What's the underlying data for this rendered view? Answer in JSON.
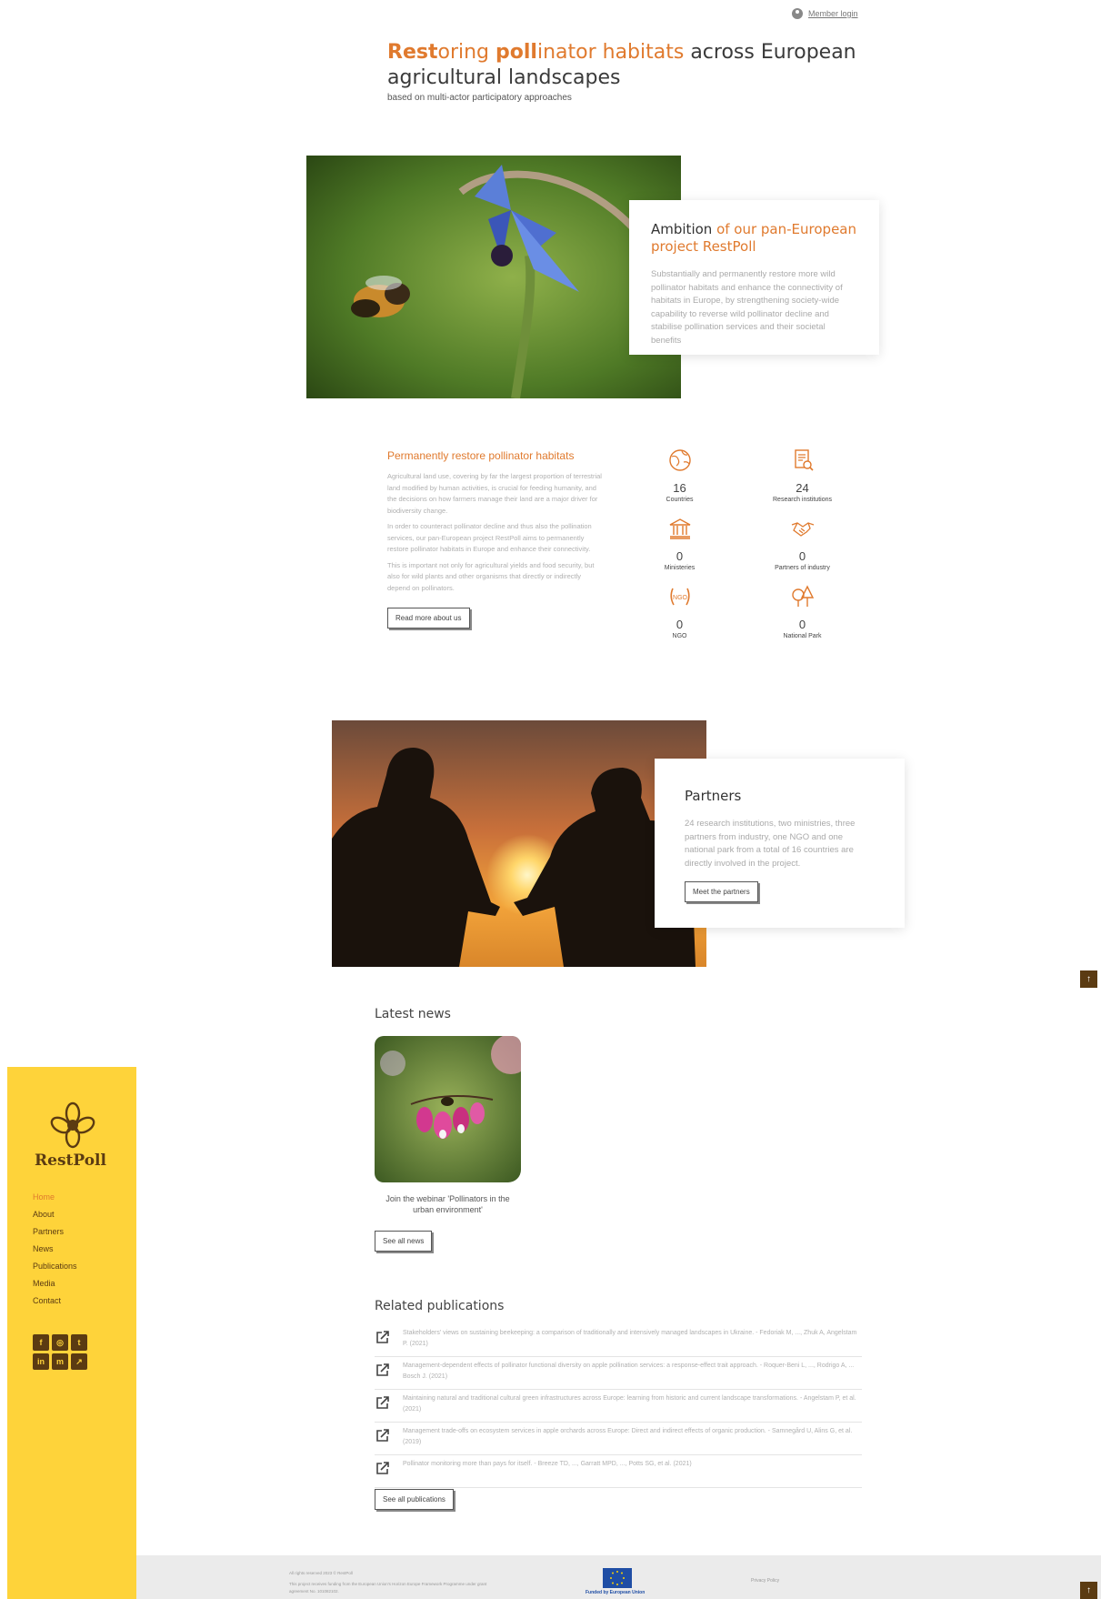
{
  "header": {
    "member_login": "Member login"
  },
  "hero": {
    "title_parts": [
      "Rest",
      "oring ",
      "poll",
      "inator habitats",
      " across European agricultural landscapes"
    ],
    "subtitle": "based on multi-actor participatory approaches"
  },
  "ambition": {
    "title_a": "Ambition",
    "title_b": " of our pan-European project RestPoll",
    "text": "Substantially and permanently restore more wild pollinator habitats and enhance the connectivity of habitats in Europe, by strengthening society-wide capability to reverse wild pollinator decline and stabilise pollination services and their societal benefits"
  },
  "restore": {
    "title": "Permanently restore pollinator habitats",
    "paragraphs": [
      "Agricultural land use, covering by far the largest proportion of terrestrial land modified by human activities, is crucial for feeding humanity, and the decisions on how farmers manage their land are a major driver for biodiversity change.",
      "In order to counteract pollinator decline and thus also the pollination services, our pan-European project RestPoll aims to permanently restore pollinator habitats in Europe and enhance their connectivity.",
      "This is important not only for agricultural yields and food security, but also for wild plants and other organisms that directly or indirectly depend on pollinators."
    ],
    "button": "Read more about us"
  },
  "stats": [
    {
      "icon": "globe-icon",
      "value": "16",
      "label": "Countries"
    },
    {
      "icon": "research-document-icon",
      "value": "24",
      "label": "Research institutions"
    },
    {
      "icon": "ministry-building-icon",
      "value": "0",
      "label": "Ministeries"
    },
    {
      "icon": "handshake-icon",
      "value": "0",
      "label": "Partners of industry"
    },
    {
      "icon": "ngo-laurel-icon",
      "value": "0",
      "label": "NGO"
    },
    {
      "icon": "trees-icon",
      "value": "0",
      "label": "National Park"
    }
  ],
  "partners": {
    "title": "Partners",
    "text": "24 research institutions, two ministries, three partners from industry, one NGO and one national park from a total of 16 countries are directly involved in the project.",
    "button": "Meet the partners"
  },
  "news": {
    "title": "Latest news",
    "item_caption": "Join the webinar 'Pollinators in the urban environment'",
    "button": "See all news"
  },
  "publications": {
    "title": "Related publications",
    "items": [
      "Stakeholders' views on sustaining beekeeping: a comparison of traditionally and intensively managed landscapes in Ukraine. - Fedoriak M, ..., Zhuk A, Angelstam P. (2021)",
      "Management-dependent effects of pollinator functional diversity on apple pollination services: a response-effect trait approach. - Roquer-Beni L, ..., Rodrigo A, ... Bosch J. (2021)",
      "Maintaining natural and traditional cultural green infrastructures across Europe: learning from historic and current landscape transformations. - Angelstam P, et al. (2021)",
      "Management trade-offs on ecosystem services in apple orchards across Europe: Direct and indirect effects of organic production. - Samnegård U, Alins G, et al. (2019)",
      "Pollinator monitoring more than pays for itself. - Breeze TD, ..., Garratt MPD, ..., Potts SG, et al. (2021)"
    ],
    "button": "See all publications"
  },
  "sidebar": {
    "brand": "RestPoll",
    "nav": [
      "Home",
      "About",
      "Partners",
      "News",
      "Publications",
      "Media",
      "Contact"
    ],
    "socials": [
      {
        "icon": "facebook-icon",
        "glyph": "f"
      },
      {
        "icon": "instagram-icon",
        "glyph": "◎"
      },
      {
        "icon": "twitter-icon",
        "glyph": "t"
      },
      {
        "icon": "linkedin-icon",
        "glyph": "in"
      },
      {
        "icon": "mastodon-icon",
        "glyph": "m"
      },
      {
        "icon": "external-link-icon",
        "glyph": "↗"
      }
    ]
  },
  "footer": {
    "copyright": "All rights reserved 2023 © RestPoll",
    "funding_text": "This project receives funding from the European Union's Horizon Europe Framework Programme under grant agreement No. 101082102.",
    "eu_label": "Funded by European Union",
    "privacy": "Privacy Policy"
  },
  "colors": {
    "accent": "#e07a2e",
    "sidebar": "#fed33a",
    "brown": "#5b3b12"
  }
}
